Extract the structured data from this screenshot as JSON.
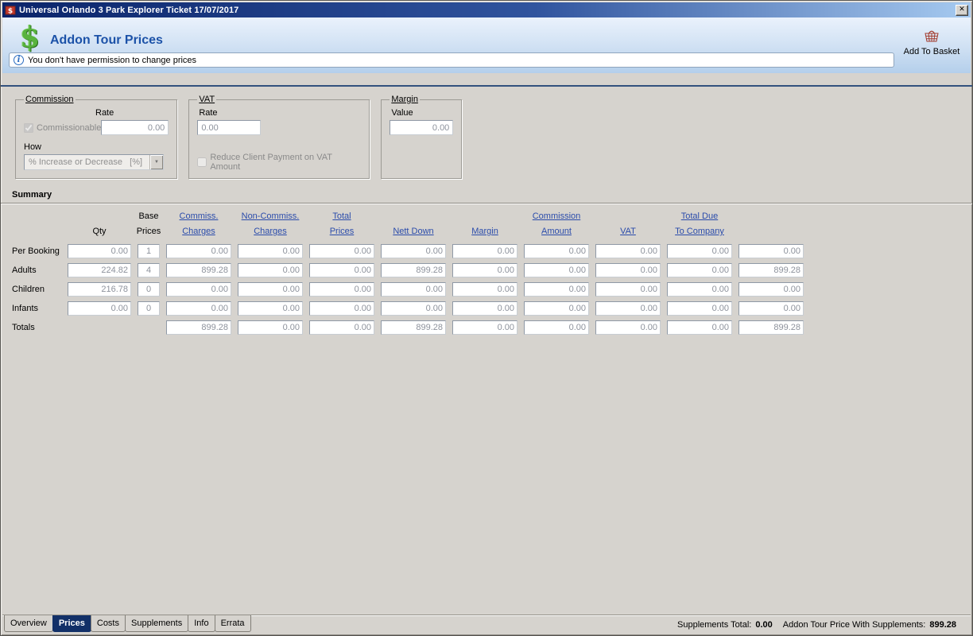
{
  "window": {
    "title": "Universal Orlando 3 Park Explorer Ticket 17/07/2017"
  },
  "icons": {
    "dollar": "$",
    "close": "✕",
    "dropdown": "▼",
    "info": "i"
  },
  "header": {
    "title": "Addon Tour Prices",
    "add_to_basket_label": "Add To Basket",
    "notice": "You don't have permission to change prices"
  },
  "commission": {
    "legend": "Commission",
    "rate_label": "Rate",
    "rate_value": "0.00",
    "commissionable_label": "Commissionable",
    "commissionable_checked": "checked",
    "how_label": "How",
    "how_value": "% Increase or Decrease   [%]"
  },
  "vat": {
    "legend": "VAT",
    "rate_label": "Rate",
    "rate_value": "0.00",
    "reduce_label": "Reduce Client Payment on VAT Amount"
  },
  "margin_box": {
    "legend": "Margin",
    "value_label": "Value",
    "value": "0.00"
  },
  "summary": {
    "title": "Summary",
    "columns": [
      {
        "line1": "",
        "line2": ""
      },
      {
        "line1": "",
        "line2": "Qty"
      },
      {
        "line1": "Base",
        "line2": "Prices"
      },
      {
        "line1": "Commiss.",
        "line2": "Charges"
      },
      {
        "line1": "Non-Commiss.",
        "line2": "Charges"
      },
      {
        "line1": "Total",
        "line2": "Prices"
      },
      {
        "line1": "",
        "line2": "Nett Down"
      },
      {
        "line1": "",
        "line2": "Margin"
      },
      {
        "line1": "Commission",
        "line2": "Amount"
      },
      {
        "line1": "",
        "line2": "VAT"
      },
      {
        "line1": "Total Due",
        "line2": "To Company"
      }
    ],
    "rows": [
      {
        "label": "Per Booking",
        "cells": [
          "0.00",
          "1",
          "0.00",
          "0.00",
          "0.00",
          "0.00",
          "0.00",
          "0.00",
          "0.00",
          "0.00",
          "0.00"
        ]
      },
      {
        "label": "Adults",
        "cells": [
          "224.82",
          "4",
          "899.28",
          "0.00",
          "0.00",
          "899.28",
          "0.00",
          "0.00",
          "0.00",
          "0.00",
          "899.28"
        ]
      },
      {
        "label": "Children",
        "cells": [
          "216.78",
          "0",
          "0.00",
          "0.00",
          "0.00",
          "0.00",
          "0.00",
          "0.00",
          "0.00",
          "0.00",
          "0.00"
        ]
      },
      {
        "label": "Infants",
        "cells": [
          "0.00",
          "0",
          "0.00",
          "0.00",
          "0.00",
          "0.00",
          "0.00",
          "0.00",
          "0.00",
          "0.00",
          "0.00"
        ]
      }
    ],
    "totals": {
      "label": "Totals",
      "cells": [
        "899.28",
        "0.00",
        "0.00",
        "899.28",
        "0.00",
        "0.00",
        "0.00",
        "0.00",
        "899.28"
      ]
    }
  },
  "tabs": {
    "items": [
      "Overview",
      "Prices",
      "Costs",
      "Supplements",
      "Info",
      "Errata"
    ],
    "active": "Prices"
  },
  "status": {
    "supplements_label": "Supplements Total:",
    "supplements_value": "0.00",
    "with_supplements_label": "Addon Tour Price With Supplements:",
    "with_supplements_value": "899.28"
  }
}
